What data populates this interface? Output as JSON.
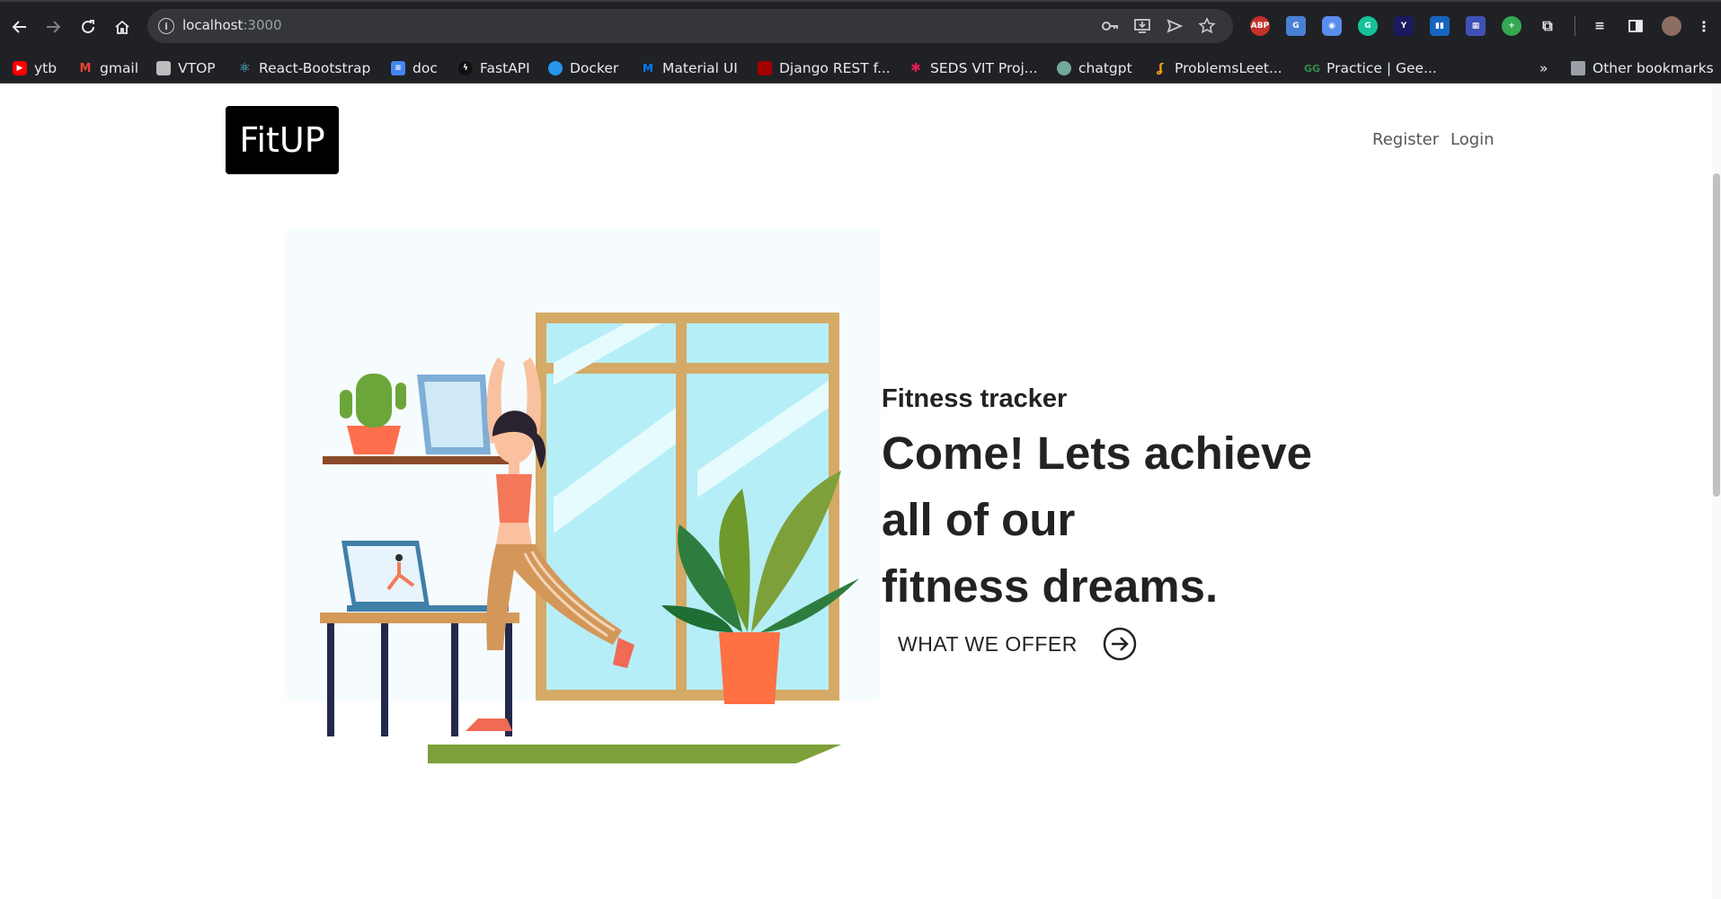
{
  "browser": {
    "url_host": "localhost",
    "url_port": ":3000",
    "bookmarks": [
      {
        "label": "ytb",
        "icon": "youtube-icon",
        "color": "#ff0000"
      },
      {
        "label": "gmail",
        "icon": "gmail-icon",
        "color": "#ea4335"
      },
      {
        "label": "VTOP",
        "icon": "vtop-icon",
        "color": "#9e9e9e"
      },
      {
        "label": "React-Bootstrap",
        "icon": "react-icon",
        "color": "#61dafb"
      },
      {
        "label": "doc",
        "icon": "docs-icon",
        "color": "#4285f4"
      },
      {
        "label": "FastAPI",
        "icon": "fastapi-icon",
        "color": "#000000"
      },
      {
        "label": "Docker",
        "icon": "docker-icon",
        "color": "#2496ed"
      },
      {
        "label": "Material UI",
        "icon": "mui-icon",
        "color": "#007fff"
      },
      {
        "label": "Django REST f...",
        "icon": "django-icon",
        "color": "#a30000"
      },
      {
        "label": "SEDS VIT Proj...",
        "icon": "slack-icon",
        "color": "#e01e5a"
      },
      {
        "label": "chatgpt",
        "icon": "chatgpt-icon",
        "color": "#74aa9c"
      },
      {
        "label": "ProblemsLeet...",
        "icon": "leetcode-icon",
        "color": "#ffa116"
      },
      {
        "label": "Practice | Gee...",
        "icon": "gfg-icon",
        "color": "#2f8d46"
      }
    ],
    "overflow": "»",
    "other_bookmarks": "Other bookmarks"
  },
  "site": {
    "logo": "FitUP",
    "nav": {
      "register": "Register",
      "login": "Login"
    },
    "hero": {
      "subtitle": "Fitness tracker",
      "headline": [
        "Come! Lets achieve",
        "all of our",
        "fitness dreams."
      ],
      "cta": "WHAT WE OFFER"
    }
  },
  "colors": {
    "accent_skin": "#f9a07f",
    "window_frame": "#d4aa66",
    "plant_green": "#2f7d3e",
    "pot_orange": "#ff7043"
  }
}
